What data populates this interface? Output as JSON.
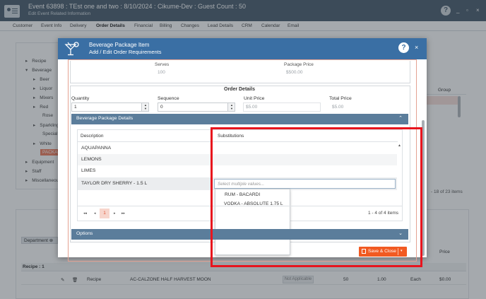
{
  "app": {
    "title": "Event 63898 : TEst one and two : 8/10/2024 : Cikume-Dev : Guest Count : 50",
    "subtitle": "Edit Event Related Information",
    "help": "?",
    "win_minimize": "_",
    "win_restore": "▫",
    "win_close": "×",
    "tabs": [
      "Customer",
      "Event Info",
      "Delivery",
      "Order Details",
      "Financial",
      "Billing",
      "Changes",
      "Lead Details",
      "CRM",
      "Calendar",
      "Email"
    ],
    "active_tab": "Order Details"
  },
  "tree": {
    "items": [
      {
        "label": "Recipe",
        "caret": "▸"
      },
      {
        "label": "Beverage",
        "caret": "▾"
      },
      {
        "label": "Beer",
        "caret": "▸"
      },
      {
        "label": "Liquor",
        "caret": "▸"
      },
      {
        "label": "Mixers",
        "caret": "▸"
      },
      {
        "label": "Red",
        "caret": "▸"
      },
      {
        "label": "Rose",
        "caret": ""
      },
      {
        "label": "Sparkling",
        "caret": "▸"
      },
      {
        "label": "Special",
        "caret": ""
      },
      {
        "label": "White",
        "caret": "▸"
      },
      {
        "label": "PACKAGE",
        "caret": ""
      },
      {
        "label": "Equipment",
        "caret": "▸"
      },
      {
        "label": "Staff",
        "caret": "▸"
      },
      {
        "label": "Miscellaneous",
        "caret": "▸"
      }
    ]
  },
  "grid_right": {
    "group_header": "Group",
    "count": "- 18 of 23 items"
  },
  "lower": {
    "department_chip": "Department",
    "chip_close": "⊗",
    "recipe_group": "Recipe : 1",
    "price_header": "Price",
    "row": {
      "type": "Recipe",
      "item": "AC-CALZONE HALF HARVEST MOON",
      "status": "Not Applicable",
      "qty": "50",
      "rate": "1.00",
      "unit": "Each",
      "price": "$0.00"
    }
  },
  "modal": {
    "title": "Beverage Package Item",
    "subtitle": "Add / Edit Order Requirements",
    "help": "?",
    "close": "×",
    "package": {
      "serves_label": "Serves",
      "serves_value": "100",
      "price_label": "Package Price",
      "price_value": "$500.00"
    },
    "order_details": {
      "title": "Order Details",
      "quantity_label": "Quantity",
      "quantity_value": "1",
      "sequence_label": "Sequence",
      "sequence_value": "0",
      "unit_price_label": "Unit Price",
      "unit_price_value": "$5.00",
      "total_price_label": "Total Price",
      "total_price_value": "$5.00"
    },
    "bev_details": {
      "title": "Beverage Package Details",
      "col_description": "Description",
      "col_substitutions": "Substitutions",
      "rows": [
        "AQUAPANNA",
        "LEMONS",
        "LIMES",
        "TAYLOR DRY SHERRY - 1.5 L"
      ],
      "multiselect_placeholder": "Select multiple values...",
      "options": [
        "RUM - BACARDI",
        "VODKA - ABSOLUTE 1.75 L"
      ],
      "pager": {
        "first": "◂◂",
        "prev": "◂",
        "current": "1",
        "next": "▸",
        "last": "▸▸",
        "info": "1 - 4 of 4 items"
      }
    },
    "options_title": "Options",
    "save_close": "Save & Close",
    "save_caret": "▾",
    "chevron_up": "⌃",
    "chevron_down": "⌄"
  },
  "colors": {
    "header_bg": "#4a5d6e",
    "modal_header": "#3a6fa4",
    "section_bar": "#5b7d9b",
    "accent": "#f15a22",
    "highlight": "#e8141d"
  }
}
